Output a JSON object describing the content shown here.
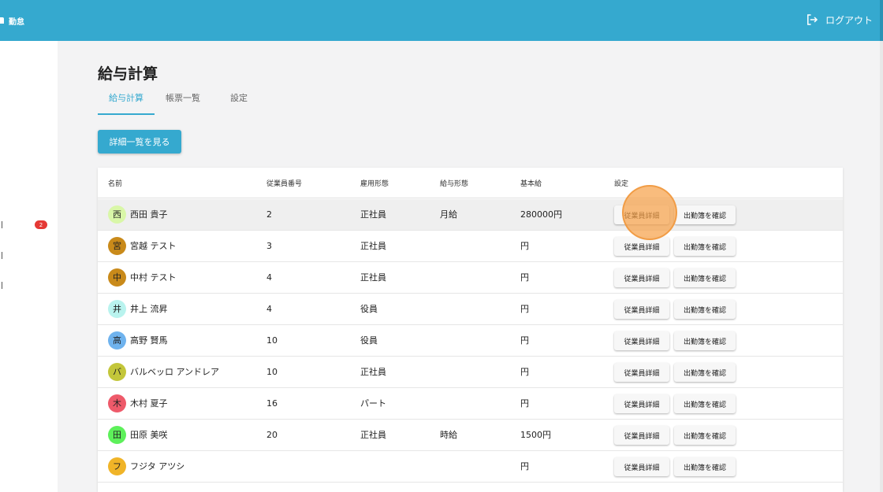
{
  "header": {
    "brand": "勤怠",
    "logout_label": "ログアウト"
  },
  "sidebar": {
    "badge_count": "2"
  },
  "page": {
    "title": "給与計算",
    "tabs": [
      {
        "label": "給与計算",
        "active": true
      },
      {
        "label": "帳票一覧",
        "active": false
      },
      {
        "label": "設定",
        "active": false
      }
    ],
    "detail_button_label": "詳細一覧を見る"
  },
  "table": {
    "headers": [
      "名前",
      "従業員番号",
      "雇用形態",
      "給与形態",
      "基本給",
      "設定"
    ],
    "employee_button_label": "従業員詳細",
    "attendance_button_label": "出勤簿を確認",
    "rows": [
      {
        "initial": "西",
        "name": "西田 貴子",
        "number": "2",
        "employment": "正社員",
        "pay_type": "月給",
        "base_pay": "280000円",
        "avatar_color": "#d9f7a8"
      },
      {
        "initial": "宮",
        "name": "宮越 テスト",
        "number": "3",
        "employment": "正社員",
        "pay_type": "",
        "base_pay": "円",
        "avatar_color": "#c98a1a"
      },
      {
        "initial": "中",
        "name": "中村 テスト",
        "number": "4",
        "employment": "正社員",
        "pay_type": "",
        "base_pay": "円",
        "avatar_color": "#c98a1a"
      },
      {
        "initial": "井",
        "name": "井上 流昇",
        "number": "4",
        "employment": "役員",
        "pay_type": "",
        "base_pay": "円",
        "avatar_color": "#b9f3ee"
      },
      {
        "initial": "高",
        "name": "高野 賢馬",
        "number": "10",
        "employment": "役員",
        "pay_type": "",
        "base_pay": "円",
        "avatar_color": "#6fb3ee"
      },
      {
        "initial": "バ",
        "name": "バルベッロ アンドレア",
        "number": "10",
        "employment": "正社員",
        "pay_type": "",
        "base_pay": "円",
        "avatar_color": "#c3c63a"
      },
      {
        "initial": "木",
        "name": "木村 夏子",
        "number": "16",
        "employment": "パート",
        "pay_type": "",
        "base_pay": "円",
        "avatar_color": "#ee5a6a"
      },
      {
        "initial": "田",
        "name": "田原 美咲",
        "number": "20",
        "employment": "正社員",
        "pay_type": "時給",
        "base_pay": "1500円",
        "avatar_color": "#5df05a"
      },
      {
        "initial": "フ",
        "name": "フジタ アツシ",
        "number": "",
        "employment": "",
        "pay_type": "",
        "base_pay": "円",
        "avatar_color": "#f0b428"
      }
    ]
  },
  "colors": {
    "primary": "#35a9cf",
    "badge": "#e53935"
  }
}
